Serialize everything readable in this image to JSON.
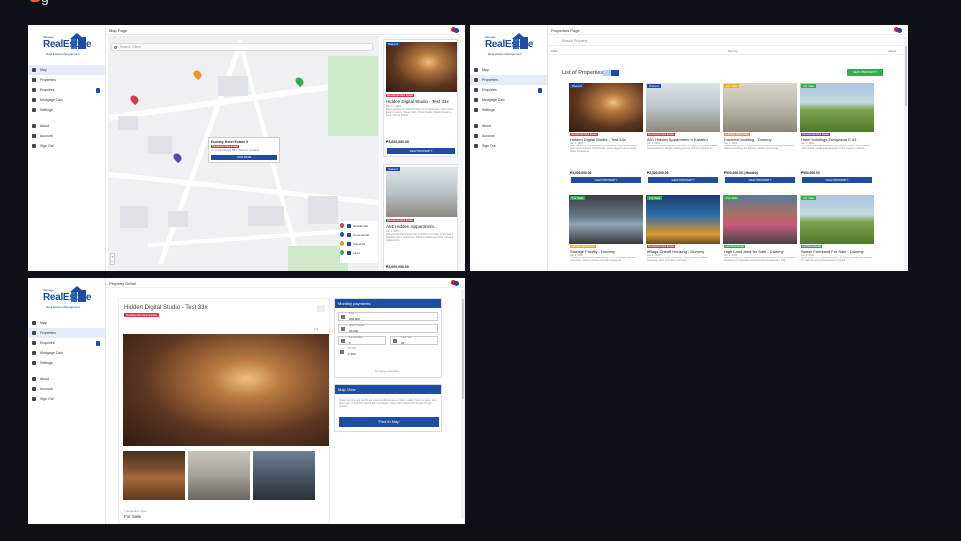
{
  "screens": {
    "map": {
      "page_title": "Map Page",
      "search_placeholder": "Search Cities",
      "popup": {
        "title": "Dummy Hotel Estate X",
        "tag": "Residential Real Estate",
        "address": "21 1 Levis Society Nb.1 Pathu St. of Nairob",
        "button": "VIEW MORE"
      },
      "legend": [
        "Residential",
        "Commercial",
        "Industrial",
        "Land"
      ],
      "legend_colors": [
        "#d13a4a",
        "#1e4ea3",
        "#e09a2a",
        "#2eae4e"
      ],
      "cards": [
        {
          "badge": "Owned",
          "tag": "Residential Real Estate",
          "title": "Hidden Digital Studio - Test 33x",
          "date": "Nov 17, 2023",
          "desc": "Dolor pariatur in euismod minim in id culpa amet. Duis lorem ipsum industry. Tamen diam. Photo Studio. Quam integer a ipsum dui ac facilisi.",
          "price": "₱3,000,000.00",
          "button": "VIEW PROPERTY"
        },
        {
          "badge": "Owned",
          "tag": "Residential Real Estate",
          "title": "A51 Hidden Appartment...",
          "date": "Jun 1, 2023",
          "desc": "Exceptional Appartment has properties for many to provide a beautiful home apartment, Modern building and lots, and bus transport for...",
          "price": "₱3,000,000.00",
          "button": "VIEW PROPERTY"
        }
      ]
    },
    "properties": {
      "page_title": "Properties Page",
      "search_placeholder": "Search Property",
      "filter_left": "Filter",
      "filter_sort": "Sort by",
      "filter_right": "Latest",
      "list_title": "List of Properties",
      "new_button": "NEW PROPERTY",
      "cards": [
        {
          "badge": "Owned",
          "badge_color": "#1e4ea3",
          "tag": "Residential Real Estate",
          "tag_color": "#d13a4a",
          "title": "Hidden Digital Studio - Test 33x",
          "date": "Jan 1, 2023",
          "desc": "Dolor pariatur in a ad dolor dolor do officia sed eligendi Ad proident lorem ipsum industry. Photo Studio. Quam integer a ipsum dui ac facilisi professional.",
          "price": "₱3,000,000.00",
          "button": "VIEW PROPERTY"
        },
        {
          "badge": "Owned",
          "badge_color": "#1e4ea3",
          "tag": "Residential Real Estate",
          "tag_color": "#d13a4a",
          "title": "A51 Hidden Appartment h Eastern",
          "date": "Jun 1, 2023",
          "desc": "Exceptional Appartment has properties for many to provide a beautiful home apartment, Modern building and lots, and bus transport for...",
          "price": "₱2,000,000.00",
          "button": "VIEW PROPERTY"
        },
        {
          "badge": "For Sale",
          "badge_color": "#e0b21b",
          "tag": "Industrial Real Estate",
          "tag_color": "#e09a2a",
          "title": "Factorial building - Dummy",
          "date": "Jan 1, 2023",
          "desc": "A factory facility with multiple industrial features including warehouse, business buildings and properly capacity commercial...",
          "price": "₱500,000.00 | Monthly",
          "button": "VIEW PROPERTY"
        },
        {
          "badge": "For Sale",
          "badge_color": "#2eae4e",
          "tag": "Commercial Real Estate",
          "tag_color": "#8b3ab8",
          "title": "Hotel buildings Zunigasoa E.43",
          "date": "Jan 1, 2023",
          "desc": "This prime retail space features high-visibility location in the bustling retail corridor, boasting ample space for the property in Manila.",
          "price": "₱500,000.00",
          "button": "VIEW PROPERTY"
        },
        {
          "badge": "For Sale",
          "badge_color": "#2eae4e",
          "tag": "Industrial Real Estate",
          "tag_color": "#e0b21b",
          "title": "Storage Facility - Dummy",
          "date": "Jan 1, 2023",
          "desc": "Providing ample, secure warehousing or commercially protected enterprises, features climate controlled storage for...",
          "price": "",
          "button": ""
        },
        {
          "badge": "For Sale",
          "badge_color": "#2eae4e",
          "tag": "Residential Real Estate",
          "tag_color": "#d13a4a",
          "title": "eBags Cheoff Housing - Dummy",
          "date": "Jan 1, 2023",
          "desc": "Affordable living, these properties is near a variety of natural resources, parks, recreation, and many...",
          "price": "",
          "button": ""
        },
        {
          "badge": "For Sale",
          "badge_color": "#2eae4e",
          "tag": "Land Real Estate",
          "tag_color": "#2eae4e",
          "title": "High Land area for Sale - Dummy",
          "date": "Jan 1, 2023",
          "desc": "Land for variety for agricultural development like more comprehensive development businesses and homestead development, shop...",
          "price": "",
          "button": ""
        },
        {
          "badge": "For Sale",
          "badge_color": "#2eae4e",
          "tag": "Land Real Estate",
          "tag_color": "#2eae4e",
          "title": "Sweet Farmland For Sale - Dummy",
          "date": "Jan 1, 2023",
          "desc": "Above growth for or agricultural use, the superb management operate for marketing and sweeting areas of natural...",
          "price": "",
          "button": ""
        }
      ]
    },
    "detail": {
      "page_title": "Property Detail",
      "title": "Hidden Digital Studio - Test 33x",
      "tag": "Residential Real Estate",
      "photo_count": "1/3",
      "type_label": "Transaction Type",
      "type_value": "For Sale",
      "monthly": {
        "header": "Monthly payments",
        "price_label": "Price",
        "price_value": "300,000",
        "down_label": "Down Payment",
        "down_value": "30,000",
        "rate_label": "Interest Rate",
        "rate_value": "5",
        "years_label": "Loan Term",
        "years_value": "20",
        "monthly_label": "Monthly",
        "monthly_value": "1,250",
        "note": "Mortgage calculator"
      },
      "map_view": {
        "header": "Map View",
        "text": "Quam sed ut a sed fa nibh vel viverra pellentesque, ut diam in dolor. Nunc eu justo, ante dolor sed, ut at dictum elementum eu aliquet. Lacus nisl et amet arcu feugiat a risus pretium.",
        "button": "Find in Map"
      }
    }
  },
  "sidebar": {
    "brand_small": "Manage",
    "brand": "RealEstate",
    "brand_sub": "Real Estate Management",
    "items": [
      "Map",
      "Properties",
      "Enquiries",
      "Mortgage Calc",
      "Settings"
    ],
    "items2": [
      "About",
      "Account",
      "Sign Out"
    ]
  }
}
